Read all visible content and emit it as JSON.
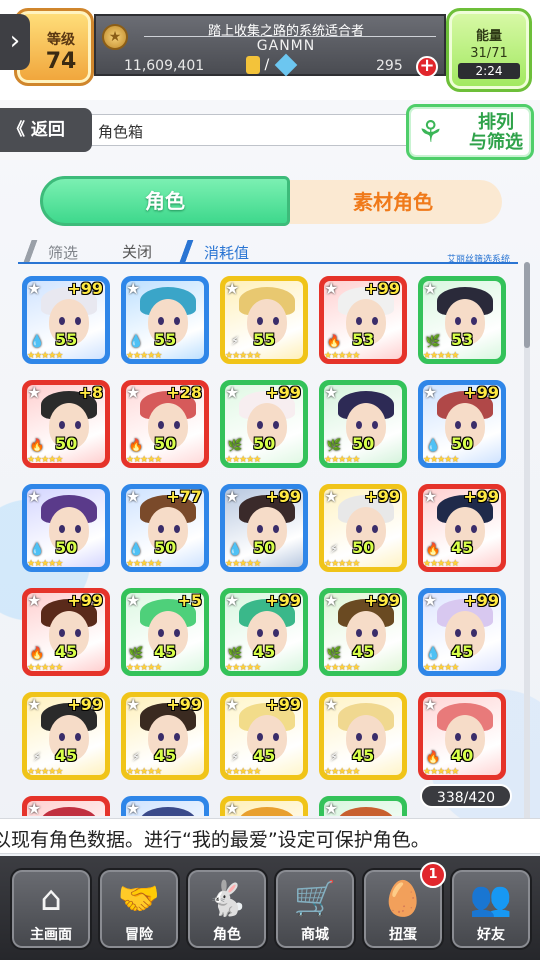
{
  "header": {
    "level_label": "等级",
    "level_value": "74",
    "title": "踏上收集之路的系统适合者",
    "username": "GANMN",
    "money": "11,609,401",
    "gem_separator": "/",
    "gems": "295",
    "energy_label": "能量",
    "energy_value": "31/71",
    "energy_timer": "2:24"
  },
  "nav": {
    "back_label": "返回",
    "breadcrumb": "角色箱",
    "sort_label_1": "排列",
    "sort_label_2": "与筛选"
  },
  "tabs": {
    "active": "角色",
    "inactive": "素材角色"
  },
  "filter": {
    "label": "筛选",
    "value": "关闭",
    "sort": "消耗值",
    "system": "艾丽丝筛选系统"
  },
  "cards": [
    {
      "bonus": "+99",
      "level": "55",
      "element": "water",
      "frame": "#2f86e8",
      "hair": "#e8e8f0",
      "bg": "#cfe3ff",
      "stars": "★★★★★"
    },
    {
      "bonus": "",
      "level": "55",
      "element": "water",
      "frame": "#2f86e8",
      "hair": "#3aa5c8",
      "bg": "#bde0ff",
      "stars": "★★★★★"
    },
    {
      "bonus": "",
      "level": "55",
      "element": "thunder",
      "frame": "#f0c419",
      "hair": "#e8c870",
      "bg": "#fff0b8",
      "stars": "★★★★★"
    },
    {
      "bonus": "+99",
      "level": "53",
      "element": "fire",
      "frame": "#e5332a",
      "hair": "#f0f0f0",
      "bg": "#ffd0d0",
      "stars": "★★★★★"
    },
    {
      "bonus": "",
      "level": "53",
      "element": "wind",
      "frame": "#34c25a",
      "hair": "#2a2a3a",
      "bg": "#d8f7df",
      "stars": "★★★★★"
    },
    {
      "bonus": "+8",
      "level": "50",
      "element": "fire",
      "frame": "#e5332a",
      "hair": "#2b2b2b",
      "bg": "#ffcfcf",
      "stars": "★★★★★"
    },
    {
      "bonus": "+28",
      "level": "50",
      "element": "fire",
      "frame": "#e5332a",
      "hair": "#d65a5a",
      "bg": "#ffdada",
      "stars": "★★★★★"
    },
    {
      "bonus": "+99",
      "level": "50",
      "element": "wind",
      "frame": "#34c25a",
      "hair": "#f7eef0",
      "bg": "#e0f8e4",
      "stars": "★★★★★"
    },
    {
      "bonus": "",
      "level": "50",
      "element": "wind",
      "frame": "#34c25a",
      "hair": "#2d2a55",
      "bg": "#d5f3dc",
      "stars": "★★★★★"
    },
    {
      "bonus": "+99",
      "level": "50",
      "element": "water",
      "frame": "#2f86e8",
      "hair": "#b04848",
      "bg": "#cfe3ff",
      "stars": "★★★★★"
    },
    {
      "bonus": "",
      "level": "50",
      "element": "water",
      "frame": "#2f86e8",
      "hair": "#5a3a8a",
      "bg": "#d4d6ff",
      "stars": "★★★★★"
    },
    {
      "bonus": "+77",
      "level": "50",
      "element": "water",
      "frame": "#2f86e8",
      "hair": "#7a4a2a",
      "bg": "#cfe3ff",
      "stars": "★★★★★"
    },
    {
      "bonus": "+99",
      "level": "50",
      "element": "water",
      "frame": "#2f86e8",
      "hair": "#3a2a2a",
      "bg": "#b8c8e0",
      "stars": "★★★★★"
    },
    {
      "bonus": "+99",
      "level": "50",
      "element": "thunder",
      "frame": "#f0c419",
      "hair": "#e8e8e8",
      "bg": "#fff3c4",
      "stars": "★★★★★"
    },
    {
      "bonus": "+99",
      "level": "45",
      "element": "fire",
      "frame": "#e5332a",
      "hair": "#1f2a4a",
      "bg": "#ffd0d0",
      "stars": "★★★★★"
    },
    {
      "bonus": "+99",
      "level": "45",
      "element": "fire",
      "frame": "#e5332a",
      "hair": "#5a2a1a",
      "bg": "#ffcfcf",
      "stars": "★★★★★"
    },
    {
      "bonus": "+5",
      "level": "45",
      "element": "wind",
      "frame": "#34c25a",
      "hair": "#4ed07a",
      "bg": "#dcf8e2",
      "stars": "★★★★★"
    },
    {
      "bonus": "+99",
      "level": "45",
      "element": "wind",
      "frame": "#34c25a",
      "hair": "#3ab88a",
      "bg": "#d8f6df",
      "stars": "★★★★★"
    },
    {
      "bonus": "+99",
      "level": "45",
      "element": "wind",
      "frame": "#34c25a",
      "hair": "#6a4a22",
      "bg": "#e0f6d8",
      "stars": "★★★★★"
    },
    {
      "bonus": "+99",
      "level": "45",
      "element": "water",
      "frame": "#2f86e8",
      "hair": "#d8c8f0",
      "bg": "#dfe6ff",
      "stars": "★★★★★"
    },
    {
      "bonus": "+99",
      "level": "45",
      "element": "thunder",
      "frame": "#f0c419",
      "hair": "#2a2a2a",
      "bg": "#fff2c0",
      "stars": "★★★★★"
    },
    {
      "bonus": "+99",
      "level": "45",
      "element": "thunder",
      "frame": "#f0c419",
      "hair": "#3a2a20",
      "bg": "#fff1bc",
      "stars": "★★★★★"
    },
    {
      "bonus": "+99",
      "level": "45",
      "element": "thunder",
      "frame": "#f0c419",
      "hair": "#f2dc8a",
      "bg": "#fff6cc",
      "stars": "★★★★★"
    },
    {
      "bonus": "",
      "level": "45",
      "element": "thunder",
      "frame": "#f0c419",
      "hair": "#f0d890",
      "bg": "#fff4c8",
      "stars": "★★★★★"
    },
    {
      "bonus": "",
      "level": "40",
      "element": "fire",
      "frame": "#e5332a",
      "hair": "#e87a7a",
      "bg": "#ffd6d6",
      "stars": "★★★★★"
    },
    {
      "bonus": "",
      "level": "",
      "element": "fire",
      "frame": "#e5332a",
      "hair": "#c03040",
      "bg": "#ffd0d0",
      "stars": ""
    },
    {
      "bonus": "",
      "level": "",
      "element": "water",
      "frame": "#2f86e8",
      "hair": "#3a4a8a",
      "bg": "#cfe3ff",
      "stars": ""
    },
    {
      "bonus": "",
      "level": "",
      "element": "thunder",
      "frame": "#f0c419",
      "hair": "#e8a030",
      "bg": "#fff0b8",
      "stars": ""
    },
    {
      "bonus": "",
      "level": "",
      "element": "wind",
      "frame": "#34c25a",
      "hair": "#c86030",
      "bg": "#d8f6df",
      "stars": ""
    }
  ],
  "element_icons": {
    "water": "💧",
    "fire": "🔥",
    "wind": "🌿",
    "thunder": "⚡"
  },
  "counter": "338/420",
  "ticker": "以现有角色数据。进行“我的最爱”设定可保护角色。",
  "bottom_nav": [
    {
      "label": "主画面",
      "icon": "home-icon",
      "glyph": "⌂"
    },
    {
      "label": "冒险",
      "icon": "handshake-icon",
      "glyph": "🤝"
    },
    {
      "label": "角色",
      "icon": "bunny-icon",
      "glyph": "🐇"
    },
    {
      "label": "商城",
      "icon": "cart-icon",
      "glyph": "🛒"
    },
    {
      "label": "扭蛋",
      "icon": "egg-icon",
      "glyph": "🥚",
      "badge": "1"
    },
    {
      "label": "好友",
      "icon": "friends-icon",
      "glyph": "👥"
    }
  ]
}
